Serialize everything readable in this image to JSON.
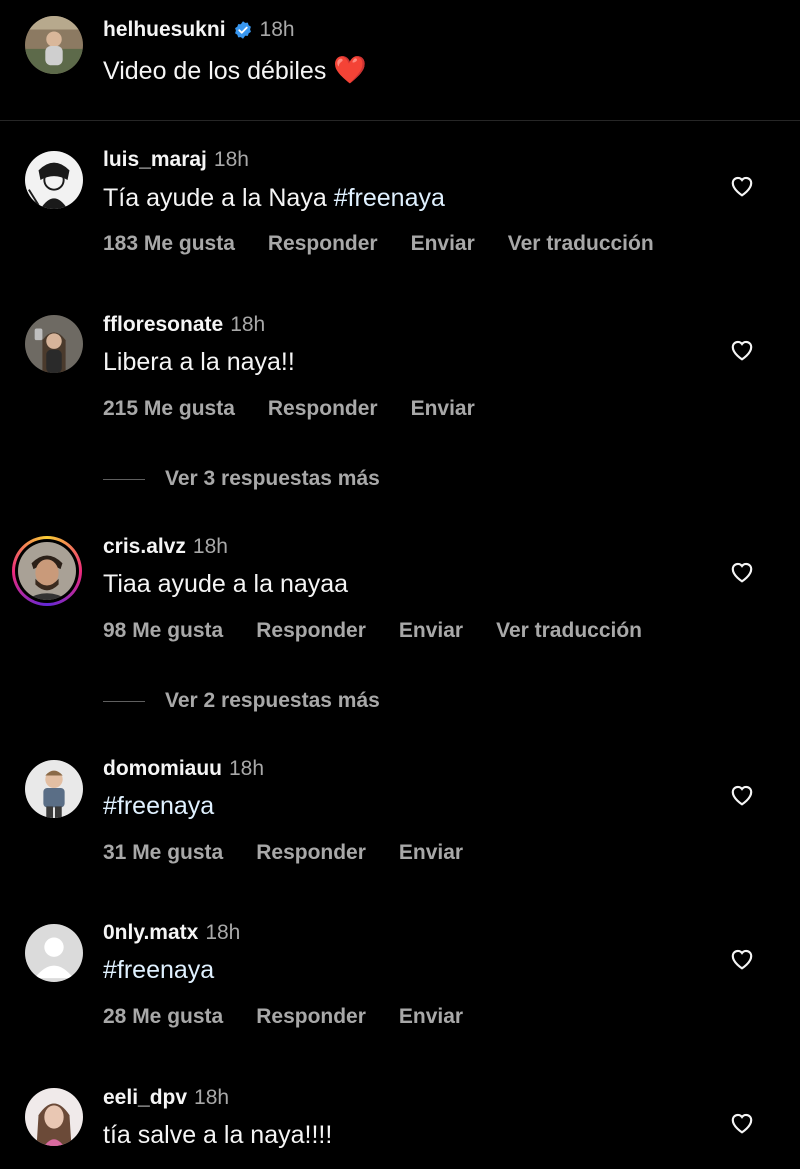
{
  "caption": {
    "username": "helhuesukni",
    "time": "18h",
    "text": "Video de los débiles",
    "emoji": "❤️",
    "verified_icon": "verified-badge-icon"
  },
  "comments": [
    {
      "username": "luis_maraj",
      "time": "18h",
      "text_prefix": "Tía ayude a la Naya ",
      "hashtag": "#freenaya",
      "likes": "183 Me gusta",
      "reply": "Responder",
      "send": "Enviar",
      "translate": "Ver traducción"
    },
    {
      "username": "ffloresonate",
      "time": "18h",
      "text": "Libera a la naya!!",
      "likes": "215 Me gusta",
      "reply": "Responder",
      "send": "Enviar",
      "more_replies": "Ver 3 respuestas más"
    },
    {
      "username": "cris.alvz",
      "time": "18h",
      "text": "Tiaa ayude a la nayaa",
      "likes": "98 Me gusta",
      "reply": "Responder",
      "send": "Enviar",
      "translate": "Ver traducción",
      "more_replies": "Ver 2 respuestas más"
    },
    {
      "username": "domomiauu",
      "time": "18h",
      "hashtag": "#freenaya",
      "likes": "31 Me gusta",
      "reply": "Responder",
      "send": "Enviar"
    },
    {
      "username": "0nly.matx",
      "time": "18h",
      "hashtag": "#freenaya",
      "likes": "28 Me gusta",
      "reply": "Responder",
      "send": "Enviar"
    },
    {
      "username": "eeli_dpv",
      "time": "18h",
      "text": "tía salve a la naya!!!!"
    }
  ],
  "colors": {
    "background": "#000000",
    "primary_text": "#f5f5f5",
    "secondary_text": "#a8a8a8",
    "hashtag": "#e0f1ff",
    "verified": "#3897f0"
  }
}
